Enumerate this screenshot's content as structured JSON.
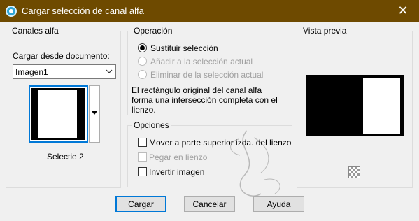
{
  "window": {
    "title": "Cargar selección de canal alfa",
    "close_glyph": "✕"
  },
  "alpha_channels": {
    "legend": "Canales alfa",
    "load_from_label": "Cargar desde documento:",
    "document_value": "Imagen1",
    "selection_name": "Selectie 2"
  },
  "operation": {
    "legend": "Operación",
    "options": [
      {
        "label": "Sustituir selección",
        "checked": true,
        "enabled": true
      },
      {
        "label": "Añadir a la selección actual",
        "checked": false,
        "enabled": false
      },
      {
        "label": "Eliminar de la selección actual",
        "checked": false,
        "enabled": false
      }
    ],
    "description": "El rectángulo original del canal alfa forma una intersección completa con el lienzo."
  },
  "options": {
    "legend": "Opciones",
    "items": [
      {
        "label": "Mover a parte superior izda. del lienzo",
        "checked": false,
        "enabled": true
      },
      {
        "label": "Pegar en lienzo",
        "checked": false,
        "enabled": false
      },
      {
        "label": "Invertir imagen",
        "checked": false,
        "enabled": true
      }
    ]
  },
  "preview": {
    "legend": "Vista previa"
  },
  "buttons": {
    "load": "Cargar",
    "cancel": "Cancelar",
    "help": "Ayuda"
  },
  "colors": {
    "titlebar": "#6e4a00",
    "accent": "#0078d7",
    "dialog_bg": "#f0f0f0"
  }
}
